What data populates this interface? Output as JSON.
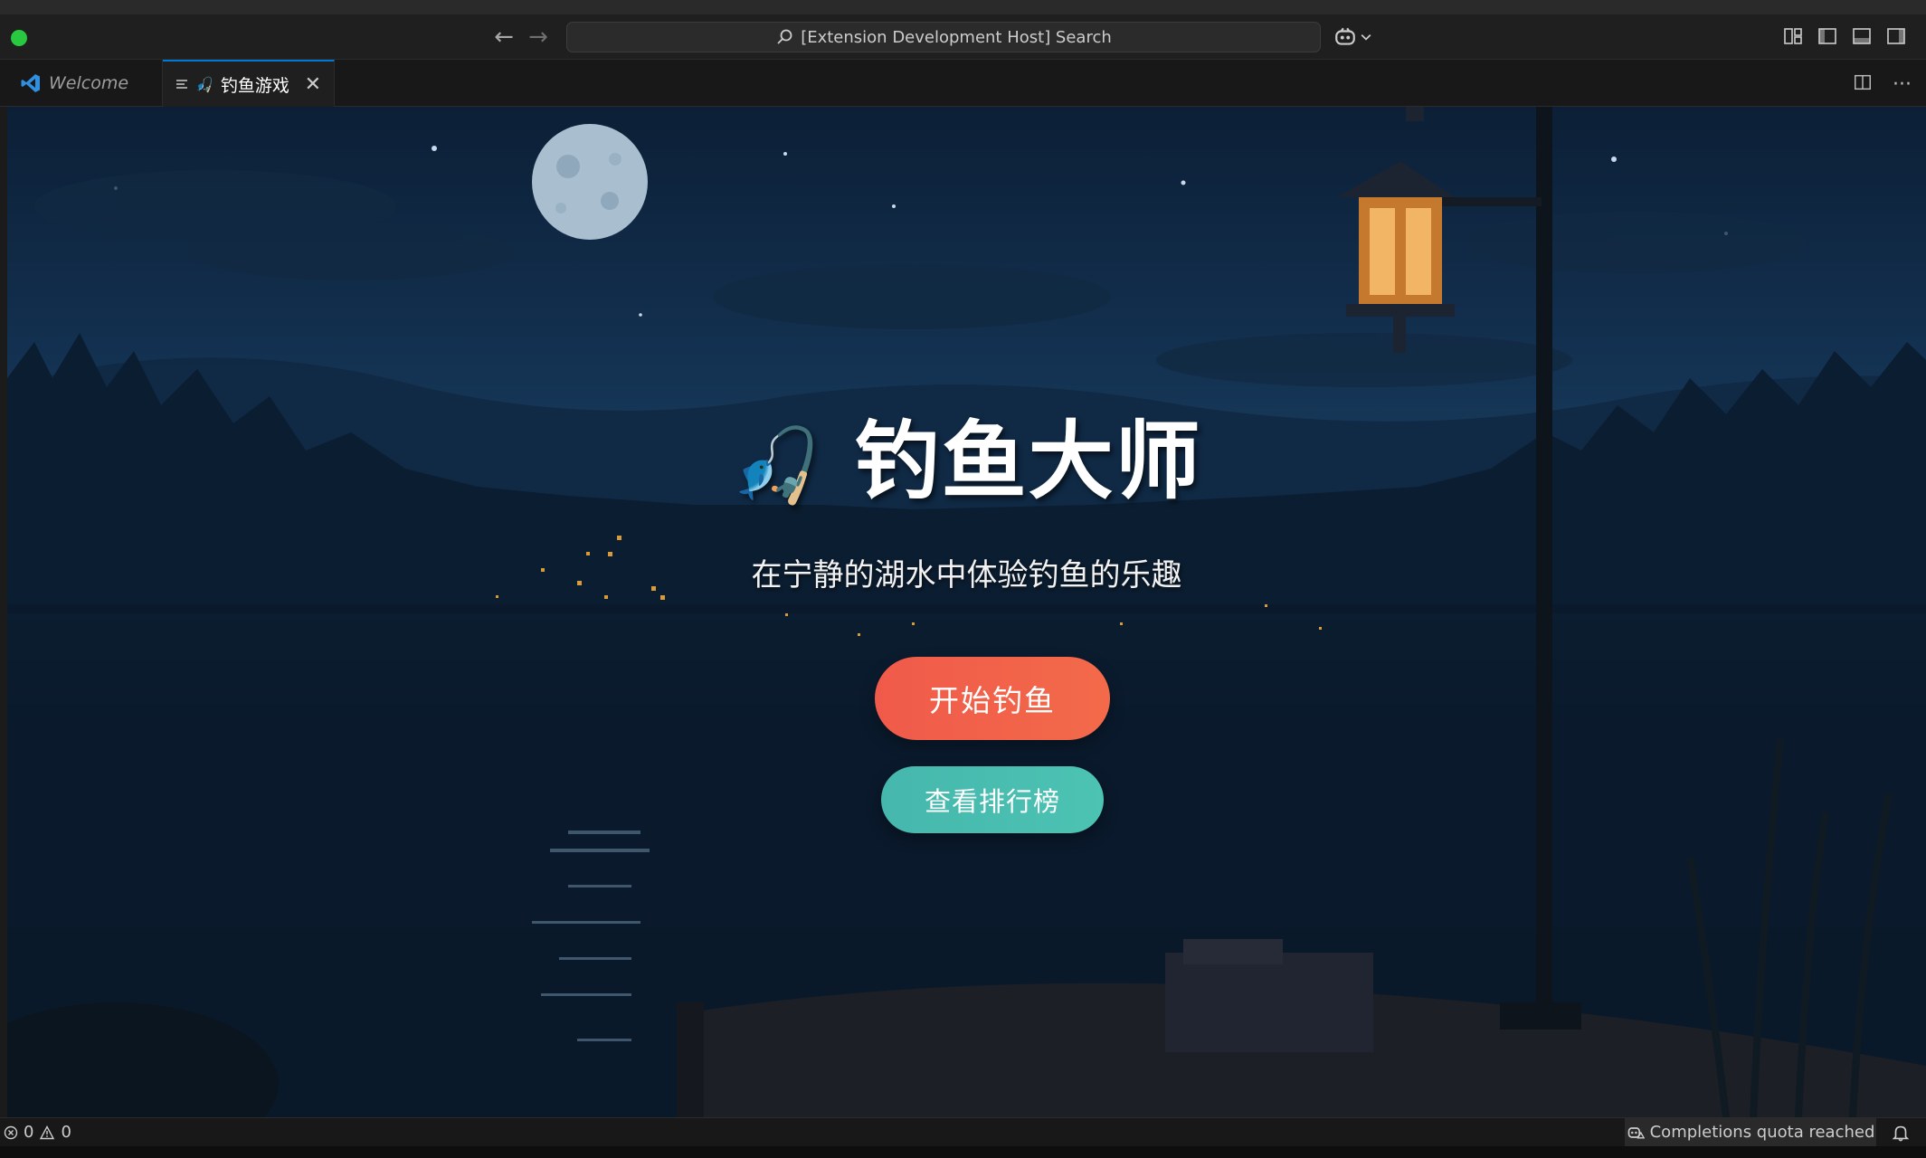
{
  "window": {
    "search_text": "[Extension Development Host] Search"
  },
  "tabs": [
    {
      "label": "Welcome",
      "icon": "vscode-logo-icon",
      "active": false
    },
    {
      "label": "钓鱼游戏",
      "icon": "fishing-emoji-icon",
      "active": true
    }
  ],
  "game": {
    "title": "钓鱼大师",
    "title_icon": "🎣",
    "subtitle": "在宁静的湖水中体验钓鱼的乐趣",
    "start_button": "开始钓鱼",
    "leaderboard_button": "查看排行榜"
  },
  "statusbar": {
    "errors": "0",
    "warnings": "0",
    "quota_text": "Completions quota reached"
  },
  "colors": {
    "accent_tab_border": "#0078d4",
    "start_button": "#f05a4a",
    "leaderboard_button": "#46b7ad",
    "traffic_light_green": "#28c840"
  }
}
